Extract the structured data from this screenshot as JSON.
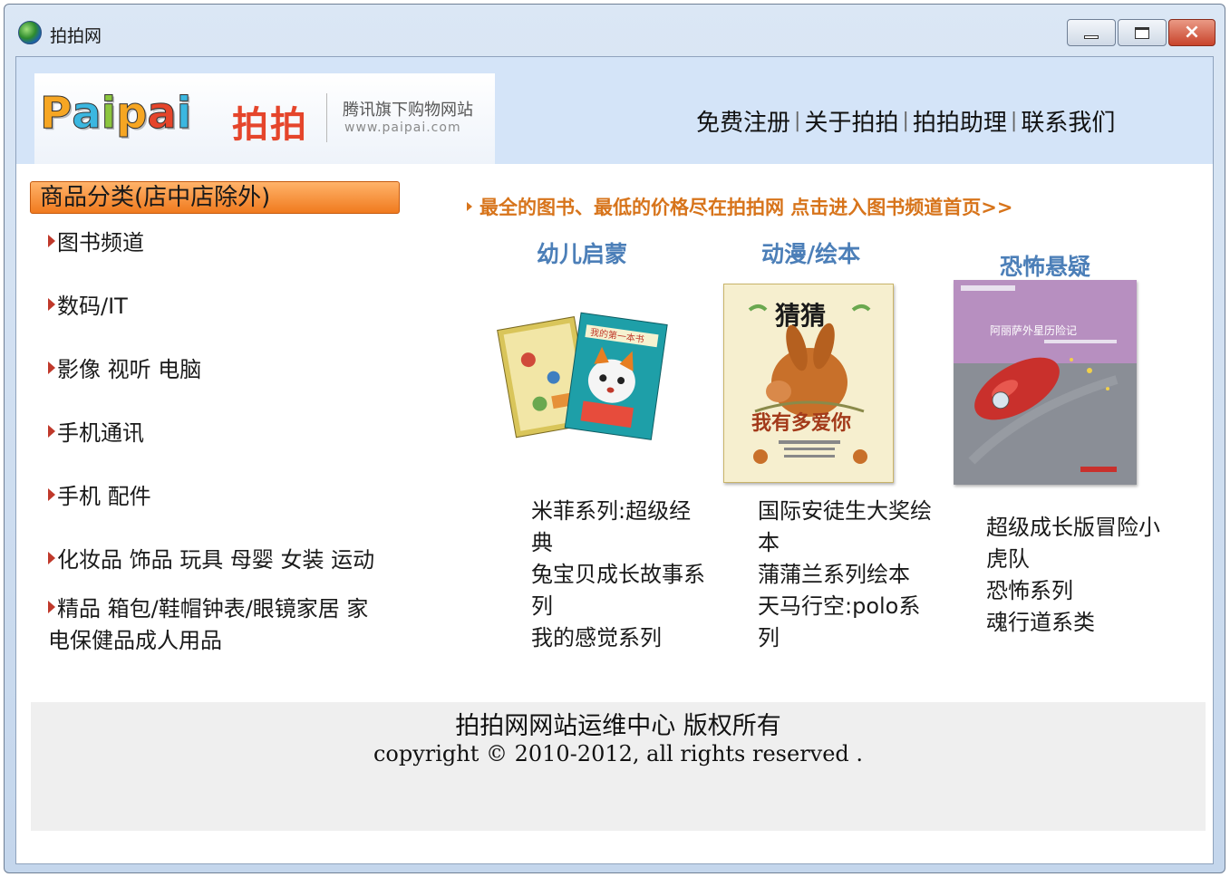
{
  "window": {
    "title": "拍拍网",
    "controls": {
      "minimize": "minimize",
      "maximize": "maximize",
      "close": "×"
    }
  },
  "header": {
    "logo": {
      "letters": [
        "P",
        "a",
        "i",
        "p",
        "a",
        "i"
      ],
      "letter_colors": [
        "#f6a623",
        "#3bb7e0",
        "#8cc63f",
        "#f6a623",
        "#e5452b",
        "#3bb7e0"
      ],
      "chinese": "拍拍",
      "slogan": "腾讯旗下购物网站",
      "url": "www.paipai.com"
    },
    "nav": [
      {
        "label": "免费注册"
      },
      {
        "label": "关于拍拍"
      },
      {
        "label": "拍拍助理"
      },
      {
        "label": "联系我们"
      }
    ],
    "nav_separator": "|"
  },
  "sidebar": {
    "header": "商品分类(店中店除外)",
    "items": [
      {
        "label": "图书频道"
      },
      {
        "label": "数码/IT"
      },
      {
        "label": "影像 视听 电脑"
      },
      {
        "label": "手机通讯"
      },
      {
        "label": "手机 配件"
      },
      {
        "label": "化妆品 饰品 玩具 母婴 女装 运动"
      },
      {
        "label": "精品 箱包/鞋帽钟表/眼镜家居 家电保健品成人用品"
      }
    ]
  },
  "main": {
    "promo": "最全的图书、最低的价格尽在拍拍网 点击进入图书频道首页>>",
    "categories": [
      {
        "title": "幼儿启蒙",
        "cover_text": [
          "我的第一本书"
        ],
        "links": [
          "米菲系列:超级经典",
          "兔宝贝成长故事系列",
          "我的感觉系列"
        ]
      },
      {
        "title": "动漫/绘本",
        "cover_text": [
          "猜猜",
          "我有多爱你"
        ],
        "links": [
          "国际安徒生大奖绘本",
          "蒲蒲兰系列绘本",
          "天马行空:polo系列"
        ]
      },
      {
        "title": "恐怖悬疑",
        "cover_text": [
          "阿丽萨外星历险记"
        ],
        "links": [
          "超级成长版冒险小虎队",
          "恐怖系列",
          "魂行道系类"
        ]
      }
    ]
  },
  "footer": {
    "line1": "拍拍网网站运维中心 版权所有",
    "line2": "copyright © 2010-2012, all rights reserved ."
  }
}
